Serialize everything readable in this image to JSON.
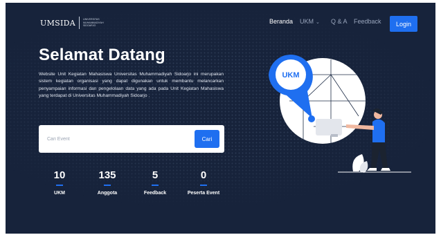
{
  "logo": {
    "name": "UMSIDA",
    "subtitle_lines": [
      "UNIVERSITAS",
      "MUHAMMADIYAH",
      "SIDOARJO"
    ]
  },
  "nav": {
    "items": [
      {
        "label": "Beranda",
        "active": true
      },
      {
        "label": "UKM",
        "has_dropdown": true
      },
      {
        "label": "Q & A"
      },
      {
        "label": "Feedback"
      }
    ],
    "login_label": "Login"
  },
  "hero": {
    "title": "Selamat Datang",
    "description": "Website Unit Kegiatan Mahasiswa Universitas Muhammadiyah Sidoarjo ini merupakan sistem kegiatan organisasi yang dapat digunakan untuk membantu melancarkan penyampaian informasi dan pengelolaan data yang ada pada Unit Kegiatan Mahasiswa yang terdapat di Universitas Muhammadiyah Sidoarjo ."
  },
  "search": {
    "placeholder": "Cari Event",
    "button_label": "Cari"
  },
  "stats": [
    {
      "value": "10",
      "label": "UKM"
    },
    {
      "value": "135",
      "label": "Anggota"
    },
    {
      "value": "5",
      "label": "Feedback"
    },
    {
      "value": "0",
      "label": "Peserta Event"
    }
  ],
  "illustration": {
    "badge_text": "UKM"
  },
  "colors": {
    "background": "#17233b",
    "accent": "#1f6ff0",
    "text": "#ffffff"
  }
}
